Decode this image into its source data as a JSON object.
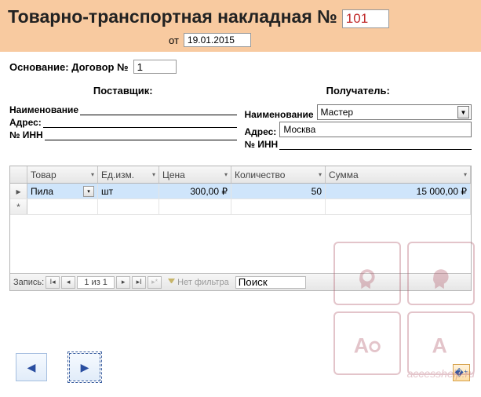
{
  "header": {
    "title": "Товарно-транспортная накладная №",
    "number": "101",
    "date_label": "от",
    "date": "19.01.2015"
  },
  "basis": {
    "label": "Основание: Договор №",
    "value": "1"
  },
  "supplier": {
    "title": "Поставщик:",
    "name_label": "Наименование",
    "name": "",
    "address_label": "Адрес:",
    "address": "",
    "inn_label": "№ ИНН",
    "inn": ""
  },
  "recipient": {
    "title": "Получатель:",
    "name_label": "Наименование",
    "name": "Мастер",
    "address_label": "Адрес:",
    "address": "Москва",
    "inn_label": "№ ИНН",
    "inn": ""
  },
  "grid": {
    "columns": [
      "Товар",
      "Ед.изм.",
      "Цена",
      "Количество",
      "Сумма"
    ],
    "rows": [
      {
        "product": "Пила",
        "unit": "шт",
        "price": "300,00 ₽",
        "qty": "50",
        "sum": "15 000,00 ₽"
      }
    ]
  },
  "recordnav": {
    "label": "Запись:",
    "position": "1 из 1",
    "nofilter": "Нет фильтра",
    "search": "Поиск"
  },
  "watermark_text": "accesshelp.ru"
}
